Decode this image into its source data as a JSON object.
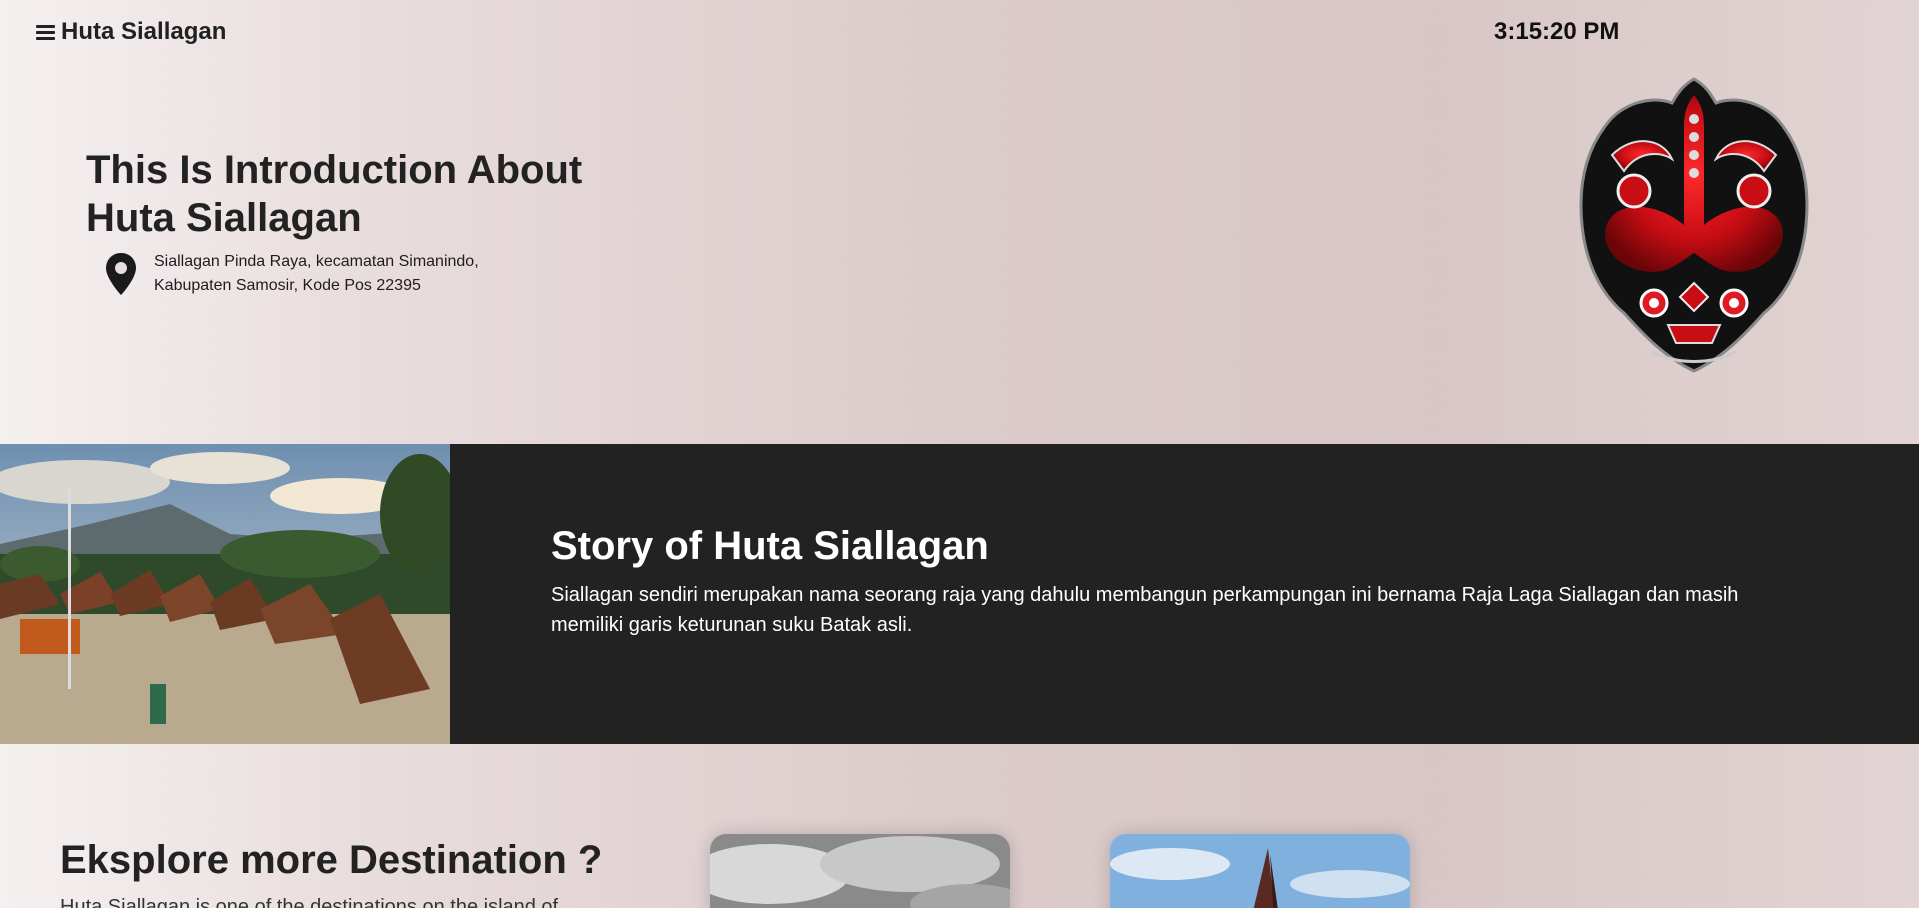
{
  "header": {
    "brand": "Huta Siallagan",
    "clock": "3:15:20 PM"
  },
  "hero": {
    "title": "This Is Introduction About Huta Siallagan",
    "address_line1": "Siallagan Pinda Raya, kecamatan Simanindo,",
    "address_line2": "Kabupaten Samosir, Kode Pos 22395"
  },
  "story": {
    "title": "Story of Huta Siallagan",
    "text": "Siallagan sendiri merupakan nama seorang raja yang dahulu membangun perkampungan ini bernama Raja Laga Siallagan dan masih memiliki garis keturunan suku Batak asli."
  },
  "explore": {
    "title": "Eksplore more Destination ?",
    "text": "Huta Siallagan is one of the destinations on the island of"
  },
  "colors": {
    "dark_band": "#222222",
    "mask_red": "#d0101a",
    "text_dark": "#212121"
  },
  "icons": {
    "menu": "hamburger-menu-icon",
    "location": "map-pin-icon"
  }
}
